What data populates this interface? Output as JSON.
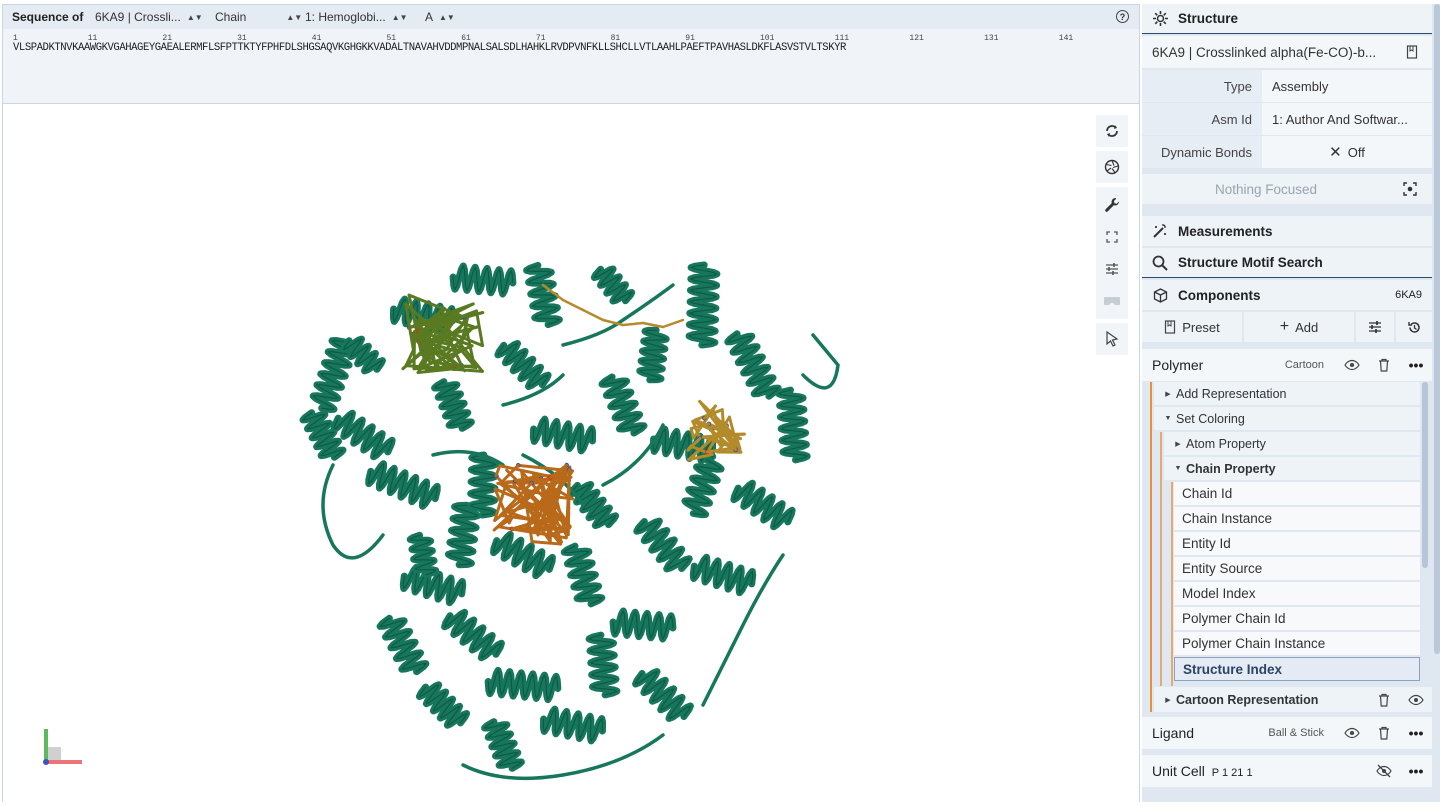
{
  "sequence": {
    "label": "Sequence of",
    "entry_select": "6KA9 | Crossli...",
    "mode_select": "Chain",
    "entity_select": "1: Hemoglobi...",
    "chain_select": "A",
    "numbers": [
      "1",
      "11",
      "21",
      "31",
      "41",
      "51",
      "61",
      "71",
      "81",
      "91",
      "101",
      "111",
      "121",
      "131",
      "141"
    ],
    "residues": "VLSPADKTNVKAAWGKVGAHAGEYGAEALERMFLSFPTTKTYFPHFDLSHGSAQVKGHGKKVADALTNAVAHVDDMPNALSALSDLHAHKLRVDPVNFKLLSHCLLVTLAAHLPAEFTPAVHASLDKFLASVSTVLTSKYR"
  },
  "structure": {
    "header": "Structure",
    "entry_value": "6KA9 | Crosslinked alpha(Fe-CO)-b...",
    "type_label": "Type",
    "type_value": "Assembly",
    "asm_label": "Asm Id",
    "asm_value": "1: Author And Softwar...",
    "dyn_label": "Dynamic Bonds",
    "dyn_value": "Off",
    "focus_text": "Nothing Focused"
  },
  "measurements": {
    "header": "Measurements"
  },
  "motif": {
    "header": "Structure Motif Search"
  },
  "components": {
    "header": "Components",
    "tag": "6KA9",
    "preset_label": "Preset",
    "add_label": "Add",
    "polymer": {
      "name": "Polymer",
      "repr": "Cartoon"
    },
    "tree": {
      "add_representation": "Add Representation",
      "set_coloring": "Set Coloring",
      "atom_property": "Atom Property",
      "chain_property": "Chain Property",
      "options": [
        "Chain Id",
        "Chain Instance",
        "Entity Id",
        "Entity Source",
        "Model Index",
        "Polymer Chain Id",
        "Polymer Chain Instance",
        "Structure Index"
      ],
      "cartoon_representation": "Cartoon Representation"
    },
    "ligand": {
      "name": "Ligand",
      "repr": "Ball & Stick"
    },
    "unit_cell": {
      "name": "Unit Cell",
      "group": "P 1 21 1"
    }
  },
  "colors": {
    "protein": "#17775d",
    "ligand_green": "#5a7a22",
    "ligand_orange": "#b86a1a",
    "ligand_gold": "#b38b2a",
    "accent_orange": "#e8903a"
  }
}
